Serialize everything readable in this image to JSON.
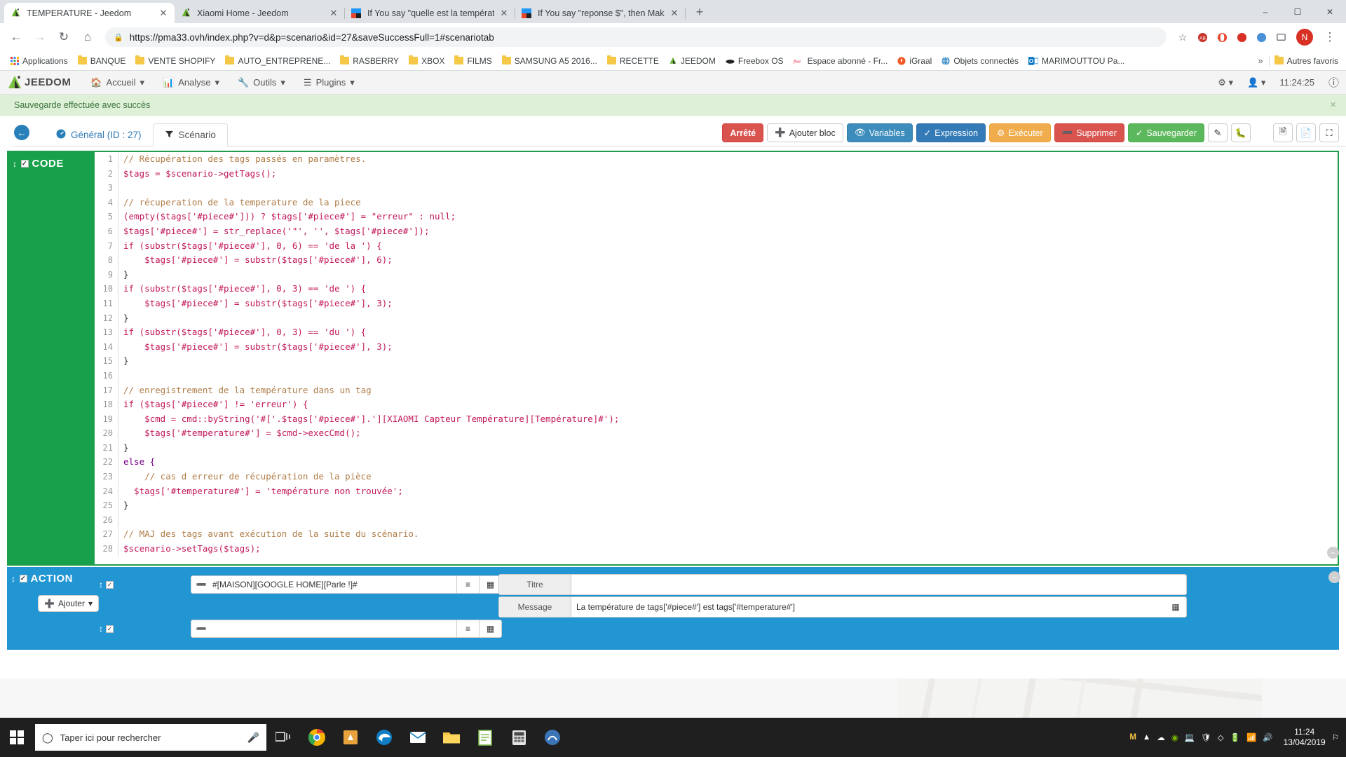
{
  "browser": {
    "tabs": [
      {
        "title": "TEMPERATURE - Jeedom",
        "favicon": "jeedom-icon",
        "active": true
      },
      {
        "title": "Xiaomi Home - Jeedom",
        "favicon": "jeedom-icon",
        "active": false
      },
      {
        "title": "If You say \"quelle est la températ",
        "favicon": "ifttt-icon",
        "active": false
      },
      {
        "title": "If You say \"reponse $\", then Make",
        "favicon": "ifttt-icon",
        "active": false
      }
    ],
    "newtab_label": "+",
    "window_controls": {
      "minimize": "–",
      "maximize": "☐",
      "close": "✕"
    },
    "url": "https://pma33.ovh/index.php?v=d&p=scenario&id=27&saveSuccessFull=1#scenariotab",
    "url_lock": "lock-icon",
    "nav": {
      "back": "←",
      "forward": "→",
      "reload": "↻",
      "home": "⌂"
    },
    "omni_icons": [
      "star-icon",
      "abp-icon",
      "opera-icon",
      "ext-icon",
      "shield-icon",
      "cast-icon"
    ],
    "profile_initial": "N",
    "menu": "⋮",
    "bookmarks": [
      {
        "label": "Applications",
        "icon": "apps-grid-icon"
      },
      {
        "label": "BANQUE",
        "icon": "folder-icon"
      },
      {
        "label": "VENTE SHOPIFY",
        "icon": "folder-icon"
      },
      {
        "label": "AUTO_ENTREPRENE...",
        "icon": "folder-icon"
      },
      {
        "label": "RASBERRY",
        "icon": "folder-icon"
      },
      {
        "label": "XBOX",
        "icon": "folder-icon"
      },
      {
        "label": "FILMS",
        "icon": "folder-icon"
      },
      {
        "label": "SAMSUNG A5 2016...",
        "icon": "folder-icon"
      },
      {
        "label": "RECETTE",
        "icon": "folder-icon"
      },
      {
        "label": "JEEDOM",
        "icon": "jeedom-icon"
      },
      {
        "label": "Freebox OS",
        "icon": "freebox-icon"
      },
      {
        "label": "Espace abonné - Fr...",
        "icon": "free-icon"
      },
      {
        "label": "iGraal",
        "icon": "igraal-icon"
      },
      {
        "label": "Objets connectés",
        "icon": "globe-icon"
      },
      {
        "label": "MARIMOUTTOU Pa...",
        "icon": "outlook-icon"
      }
    ],
    "bookmarks_overflow": "»",
    "other_bookmarks": {
      "label": "Autres favoris",
      "icon": "folder-icon"
    }
  },
  "jeedom": {
    "logo_text": "JEEDOM",
    "nav": [
      {
        "label": "Accueil",
        "icon": "home-icon",
        "caret": "▾"
      },
      {
        "label": "Analyse",
        "icon": "chart-icon",
        "caret": "▾"
      },
      {
        "label": "Outils",
        "icon": "wrench-icon",
        "caret": "▾"
      },
      {
        "label": "Plugins",
        "icon": "sliders-icon",
        "caret": "▾"
      }
    ],
    "right": [
      {
        "label": "",
        "icon": "gears-icon",
        "caret": "▾"
      },
      {
        "label": "",
        "icon": "user-icon",
        "caret": "▾"
      }
    ],
    "clock": "11:24:25",
    "help_icon": "help-circle-icon",
    "alert": {
      "text": "Sauvegarde effectuée avec succès",
      "close": "×"
    },
    "tabs": [
      {
        "label": "Général (ID : 27)",
        "icon": "dashboard-icon",
        "active": false
      },
      {
        "label": "Scénario",
        "icon": "filter-icon",
        "active": true
      }
    ],
    "back_icon": "back-arrow-icon",
    "toolbar": [
      {
        "label": "Arrêté",
        "style": "red",
        "icon": ""
      },
      {
        "label": "Ajouter bloc",
        "style": "white",
        "icon": "plus-circle-icon"
      },
      {
        "label": "Variables",
        "style": "blue2",
        "icon": "eye-icon"
      },
      {
        "label": "Expression",
        "style": "blue",
        "icon": "check-icon"
      },
      {
        "label": "Exécuter",
        "style": "orange",
        "icon": "gears-icon"
      },
      {
        "label": "Supprimer",
        "style": "danger",
        "icon": "minus-circle-icon"
      },
      {
        "label": "Sauvegarder",
        "style": "green",
        "icon": "check-circle-icon"
      }
    ],
    "toolbar_icons": [
      {
        "icon": "edit-icon"
      },
      {
        "icon": "bug-icon"
      },
      {
        "icon": "blank-icon"
      },
      {
        "icon": "log-icon"
      },
      {
        "icon": "copy-icon"
      },
      {
        "icon": "expand-icon"
      }
    ]
  },
  "code_block": {
    "title": "CODE",
    "checkbox": "✓",
    "drag_icon": "drag-vertical-icon",
    "collapse_icon": "minus-circle-icon",
    "lines": [
      {
        "n": 1,
        "text": "// Récupération des tags passés en paramètres."
      },
      {
        "n": 2,
        "text": "$tags = $scenario->getTags();"
      },
      {
        "n": 3,
        "text": ""
      },
      {
        "n": 4,
        "text": "// récuperation de la temperature de la piece"
      },
      {
        "n": 5,
        "text": "(empty($tags['#piece#'])) ? $tags['#piece#'] = \"erreur\" : null;"
      },
      {
        "n": 6,
        "text": "$tags['#piece#'] = str_replace('\"', '', $tags['#piece#']);"
      },
      {
        "n": 7,
        "text": "if (substr($tags['#piece#'], 0, 6) == 'de la ') {"
      },
      {
        "n": 8,
        "text": "    $tags['#piece#'] = substr($tags['#piece#'], 6);"
      },
      {
        "n": 9,
        "text": "}"
      },
      {
        "n": 10,
        "text": "if (substr($tags['#piece#'], 0, 3) == 'de ') {"
      },
      {
        "n": 11,
        "text": "    $tags['#piece#'] = substr($tags['#piece#'], 3);"
      },
      {
        "n": 12,
        "text": "}"
      },
      {
        "n": 13,
        "text": "if (substr($tags['#piece#'], 0, 3) == 'du ') {"
      },
      {
        "n": 14,
        "text": "    $tags['#piece#'] = substr($tags['#piece#'], 3);"
      },
      {
        "n": 15,
        "text": "}"
      },
      {
        "n": 16,
        "text": ""
      },
      {
        "n": 17,
        "text": "// enregistrement de la température dans un tag"
      },
      {
        "n": 18,
        "text": "if ($tags['#piece#'] != 'erreur') {"
      },
      {
        "n": 19,
        "text": "    $cmd = cmd::byString('#['.$tags['#piece#'].'][XIAOMI Capteur Température][Température]#');"
      },
      {
        "n": 20,
        "text": "    $tags['#temperature#'] = $cmd->execCmd();"
      },
      {
        "n": 21,
        "text": "}"
      },
      {
        "n": 22,
        "text": "else {"
      },
      {
        "n": 23,
        "text": "    // cas d erreur de récupération de la pièce"
      },
      {
        "n": 24,
        "text": "  $tags['#temperature#'] = 'température non trouvée';"
      },
      {
        "n": 25,
        "text": "}"
      },
      {
        "n": 26,
        "text": ""
      },
      {
        "n": 27,
        "text": "// MAJ des tags avant exécution de la suite du scénario."
      },
      {
        "n": 28,
        "text": "$scenario->setTags($tags);"
      }
    ]
  },
  "action_block": {
    "title": "ACTION",
    "checkbox": "✓",
    "add_label": "Ajouter",
    "add_caret": "▾",
    "rows": [
      {
        "command": "#[MAISON][GOOGLE HOME][Parle !]#",
        "placeholder": ""
      },
      {
        "command": "",
        "placeholder": ""
      }
    ],
    "options": [
      {
        "label": "Titre",
        "value": ""
      },
      {
        "label": "Message",
        "value": "La température de tags['#piece#'] est tags['#temperature#']"
      }
    ]
  },
  "taskbar": {
    "search_placeholder": "Taper ici pour rechercher",
    "search_icon": "search-circle-icon",
    "mic_icon": "microphone-icon",
    "start_icon": "windows-icon",
    "taskview_icon": "task-view-icon",
    "apps": [
      "chrome-icon",
      "store-icon",
      "edge-icon",
      "mail-icon",
      "explorer-icon",
      "notepad-icon",
      "calc-icon",
      "app-icon"
    ],
    "tray_icons": [
      "M-icon",
      "up-chevron-icon",
      "cloud-icon",
      "nvidia-icon",
      "network-icon",
      "shield-icon",
      "dropbox-icon",
      "battery-icon",
      "wifi-icon",
      "volume-icon",
      "flag-icon"
    ],
    "time": "11:24",
    "date": "13/04/2019"
  }
}
